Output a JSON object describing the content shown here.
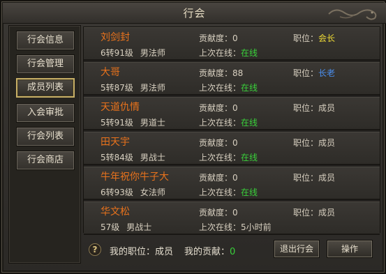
{
  "window": {
    "title": "行会"
  },
  "sidebar": {
    "tabs": [
      {
        "label": "行会信息",
        "active": false
      },
      {
        "label": "行会管理",
        "active": false
      },
      {
        "label": "成员列表",
        "active": true
      },
      {
        "label": "入会审批",
        "active": false
      },
      {
        "label": "行会列表",
        "active": false
      },
      {
        "label": "行会商店",
        "active": false
      }
    ]
  },
  "labels": {
    "contrib": "贡献度：",
    "online": "上次在线：",
    "position": "职位："
  },
  "members": [
    {
      "name": "刘剑封",
      "level": "6转91级",
      "cls": "男法师",
      "contrib": "0",
      "online": "在线",
      "online_color": "#39d13a",
      "position": "会长",
      "position_color": "#f0dc36"
    },
    {
      "name": "大哥",
      "level": "5转87级",
      "cls": "男法师",
      "contrib": "88",
      "online": "在线",
      "online_color": "#39d13a",
      "position": "长老",
      "position_color": "#4a8ff0"
    },
    {
      "name": "天道仇情",
      "level": "5转91级",
      "cls": "男道士",
      "contrib": "0",
      "online": "在线",
      "online_color": "#39d13a",
      "position": "成员",
      "position_color": "#d8d0c0"
    },
    {
      "name": "田天宇",
      "level": "5转84级",
      "cls": "男战士",
      "contrib": "0",
      "online": "在线",
      "online_color": "#39d13a",
      "position": "成员",
      "position_color": "#d8d0c0"
    },
    {
      "name": "牛年祝你牛子大",
      "level": "6转93级",
      "cls": "女法师",
      "contrib": "0",
      "online": "在线",
      "online_color": "#39d13a",
      "position": "成员",
      "position_color": "#d8d0c0"
    },
    {
      "name": "华文松",
      "level": "57级",
      "cls": "男战士",
      "contrib": "0",
      "online": "5小时前",
      "online_color": "#d8d0c0",
      "position": "成员",
      "position_color": "#d8d0c0"
    }
  ],
  "footer": {
    "help_glyph": "?",
    "my_position_label": "我的职位：",
    "my_position": "成员",
    "my_contrib_label": "我的贡献：",
    "my_contrib": "0",
    "quit_button": "退出行会",
    "operate_button": "操作"
  }
}
